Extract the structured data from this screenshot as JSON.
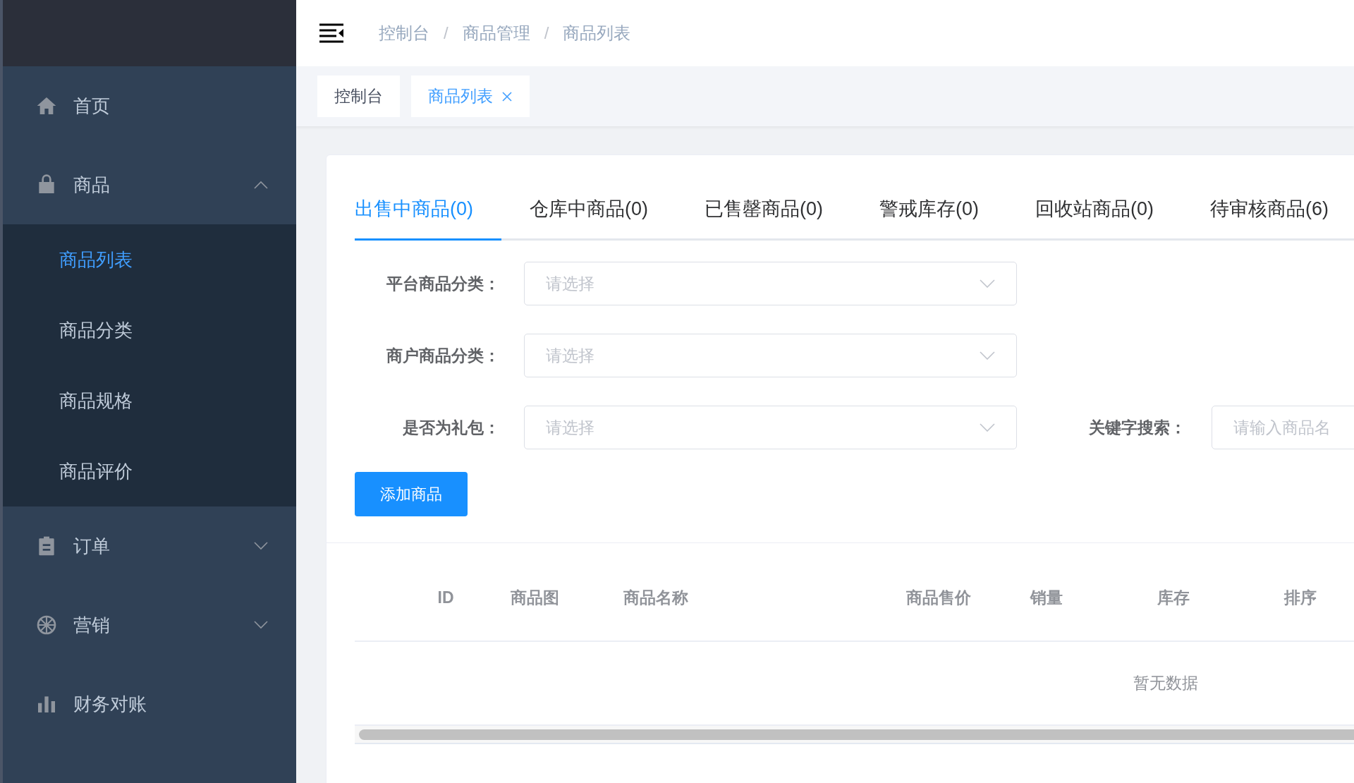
{
  "sidebar": {
    "items": [
      {
        "label": "首页",
        "kind": "link",
        "selected": false
      },
      {
        "label": "商品",
        "kind": "group",
        "selected": false,
        "expanded": true,
        "children": [
          {
            "label": "商品列表",
            "selected": true
          },
          {
            "label": "商品分类",
            "selected": false
          },
          {
            "label": "商品规格",
            "selected": false
          },
          {
            "label": "商品评价",
            "selected": false
          }
        ]
      },
      {
        "label": "订单",
        "kind": "group",
        "selected": false,
        "expanded": false
      },
      {
        "label": "营销",
        "kind": "group",
        "selected": false,
        "expanded": false
      },
      {
        "label": "财务对账",
        "kind": "link",
        "selected": false
      }
    ]
  },
  "breadcrumb": [
    "控制台",
    "商品管理",
    "商品列表"
  ],
  "breadcrumb_separator": "/",
  "tags": [
    {
      "label": "控制台",
      "selected": false,
      "closable": false
    },
    {
      "label": "商品列表",
      "selected": true,
      "closable": true
    }
  ],
  "tabs": [
    {
      "label": "出售中商品(0)",
      "selected": true
    },
    {
      "label": "仓库中商品(0)",
      "selected": false
    },
    {
      "label": "已售罄商品(0)",
      "selected": false
    },
    {
      "label": "警戒库存(0)",
      "selected": false
    },
    {
      "label": "回收站商品(0)",
      "selected": false
    },
    {
      "label": "待审核商品(6)",
      "selected": false
    }
  ],
  "filters": [
    [
      {
        "kind": "select",
        "label": "平台商品分类：",
        "placeholder": "请选择"
      }
    ],
    [
      {
        "kind": "select",
        "label": "商户商品分类：",
        "placeholder": "请选择"
      }
    ],
    [
      {
        "kind": "select",
        "label": "是否为礼包：",
        "placeholder": "请选择"
      },
      {
        "kind": "input",
        "label": "关键字搜索：",
        "placeholder": "请输入商品名"
      }
    ]
  ],
  "add_button": "添加商品",
  "table": {
    "columns": [
      "ID",
      "商品图",
      "商品名称",
      "商品售价",
      "销量",
      "库存",
      "排序"
    ],
    "empty_text": "暂无数据"
  }
}
